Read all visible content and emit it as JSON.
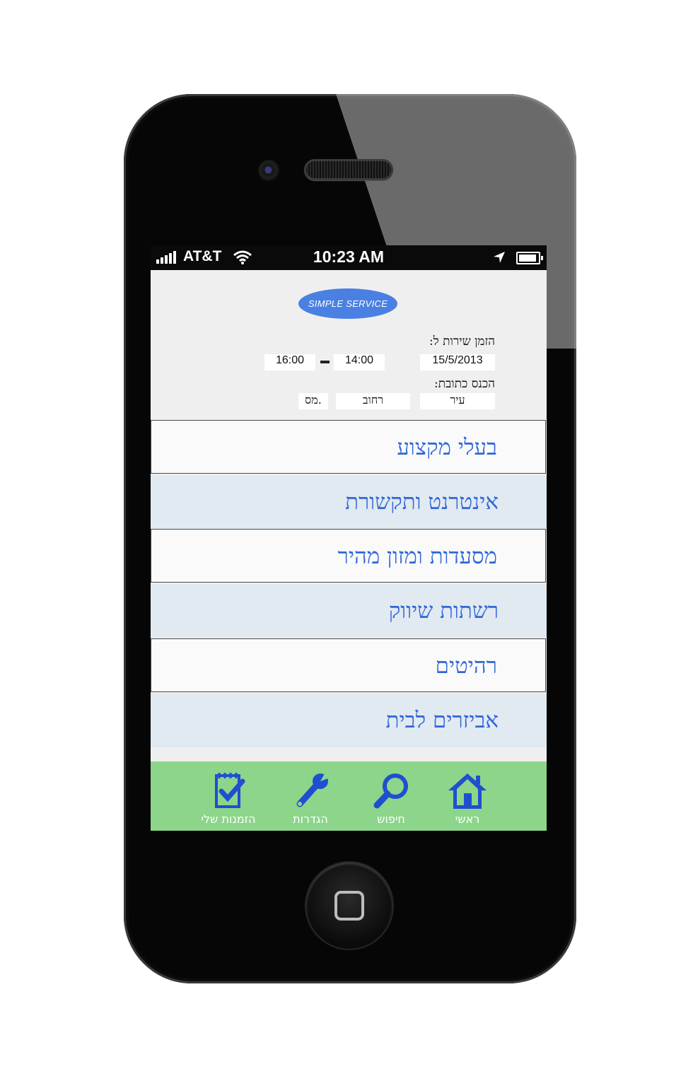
{
  "status_bar": {
    "carrier": "AT&T",
    "time": "10:23 AM"
  },
  "app": {
    "logo": "SIMPLE SERVICE"
  },
  "booking": {
    "service_time_label": "הזמן שירות ל:",
    "date": "15/5/2013",
    "time_from": "14:00",
    "time_to": "16:00",
    "address_label": "הכנס כתובת:",
    "city_placeholder": "עיר",
    "street_placeholder": "רחוב",
    "number_placeholder": "מס."
  },
  "categories": [
    "בעלי מקצוע",
    "אינטרנט ותקשורת",
    "מסעדות ומזון מהיר",
    "רשתות שיווק",
    "רהיטים",
    "אביזרים לבית"
  ],
  "tabs": [
    {
      "label": "ראשי",
      "icon": "home-icon"
    },
    {
      "label": "חיפוש",
      "icon": "magnifier-icon"
    },
    {
      "label": "הגדרות",
      "icon": "wrench-icon"
    },
    {
      "label": "הזמנות שלי",
      "icon": "checklist-icon"
    }
  ],
  "colors": {
    "accent": "#2f66d9",
    "logo": "#4a80e2",
    "tabbar": "#8cd58a",
    "icon": "#1f4fd0",
    "row_alt": "#e1e9f1"
  }
}
